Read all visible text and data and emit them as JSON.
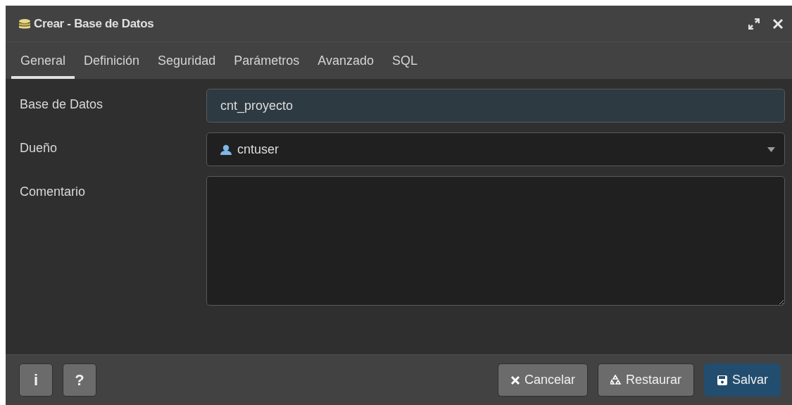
{
  "window": {
    "title": "Crear - Base de Datos"
  },
  "tabs": [
    {
      "label": "General",
      "selected": true
    },
    {
      "label": "Definición",
      "selected": false
    },
    {
      "label": "Seguridad",
      "selected": false
    },
    {
      "label": "Parámetros",
      "selected": false
    },
    {
      "label": "Avanzado",
      "selected": false
    },
    {
      "label": "SQL",
      "selected": false
    }
  ],
  "fields": [
    {
      "kind": "text",
      "label": "Base de Datos",
      "value": "cnt_proyecto"
    },
    {
      "kind": "select",
      "label": "Dueño",
      "value": "cntuser"
    },
    {
      "kind": "textarea",
      "label": "Comentario"
    }
  ],
  "footer": {
    "left_buttons": [
      {
        "label": "i"
      },
      {
        "label": "?"
      }
    ],
    "buttons": [
      {
        "kind": "cancel",
        "label": "Cancelar"
      },
      {
        "kind": "reset",
        "label": "Restaurar"
      },
      {
        "kind": "save",
        "label": "Salvar"
      }
    ]
  }
}
